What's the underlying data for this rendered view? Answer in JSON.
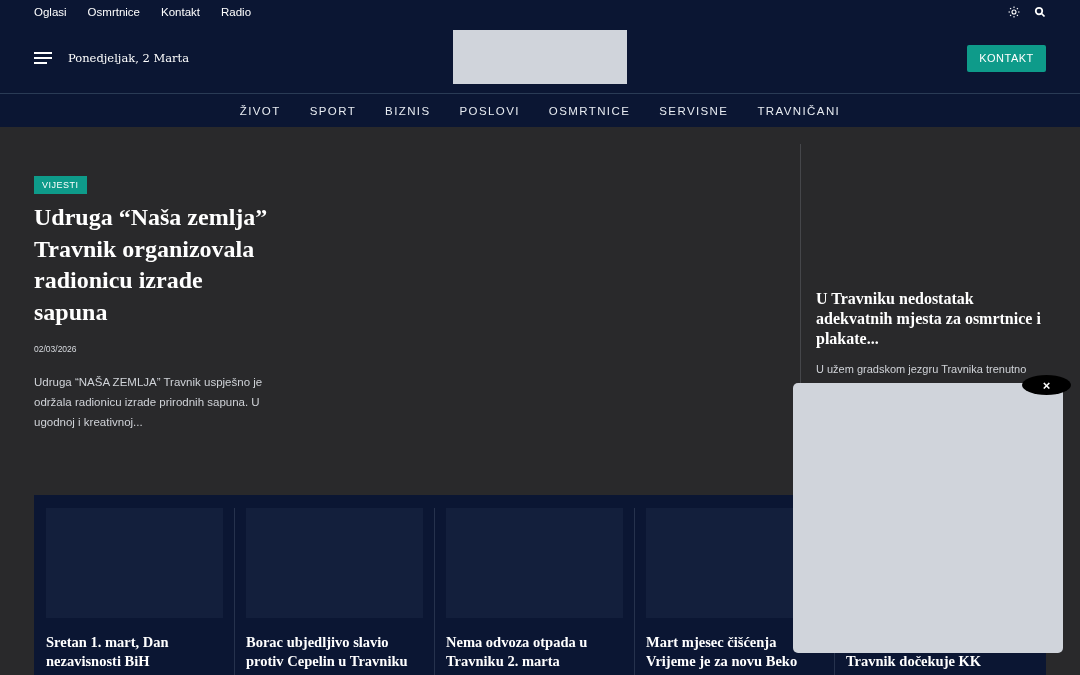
{
  "top_links": [
    "Oglasi",
    "Osmrtnice",
    "Kontakt",
    "Radio"
  ],
  "header": {
    "date": "Ponedjeljak, 2 Marta",
    "button": "KONTAKT"
  },
  "nav": [
    "ŽIVOT",
    "SPORT",
    "BIZNIS",
    "POSLOVI",
    "OSMRTNICE",
    "SERVISNE",
    "TRAVNIČANI"
  ],
  "hero": {
    "category": "VIJESTI",
    "title": "Udruga “Naša zemlja” Travnik organizovala radionicu izrade sapuna",
    "date": "02/03/2026",
    "excerpt": "Udruga “NAŠA ZEMLJA” Travnik uspješno je održala radionicu izrade prirodnih sapuna. U ugodnoj i kreativnoj..."
  },
  "side_article": {
    "title": "U Travniku nedostatak adekvatnih mjesta za osmrtnice i plakate...",
    "excerpt": "U užem gradskom jezgru Travnika trenutno"
  },
  "cards": [
    {
      "title": "Sretan 1. mart, Dan nezavisnosti BiH",
      "covered": false
    },
    {
      "title": "Borac ubjedljivo slavio protiv Cepelin u Travniku",
      "covered": false
    },
    {
      "title": "Nema odvoza otpada u Travniku 2. marta",
      "covered": false
    },
    {
      "title": "Mart mjesec čišćenja Vrijeme je za novu Beko",
      "covered": false
    },
    {
      "title": "Travnik dočekuje KK",
      "covered": true
    }
  ],
  "ad": {
    "close": "×"
  }
}
